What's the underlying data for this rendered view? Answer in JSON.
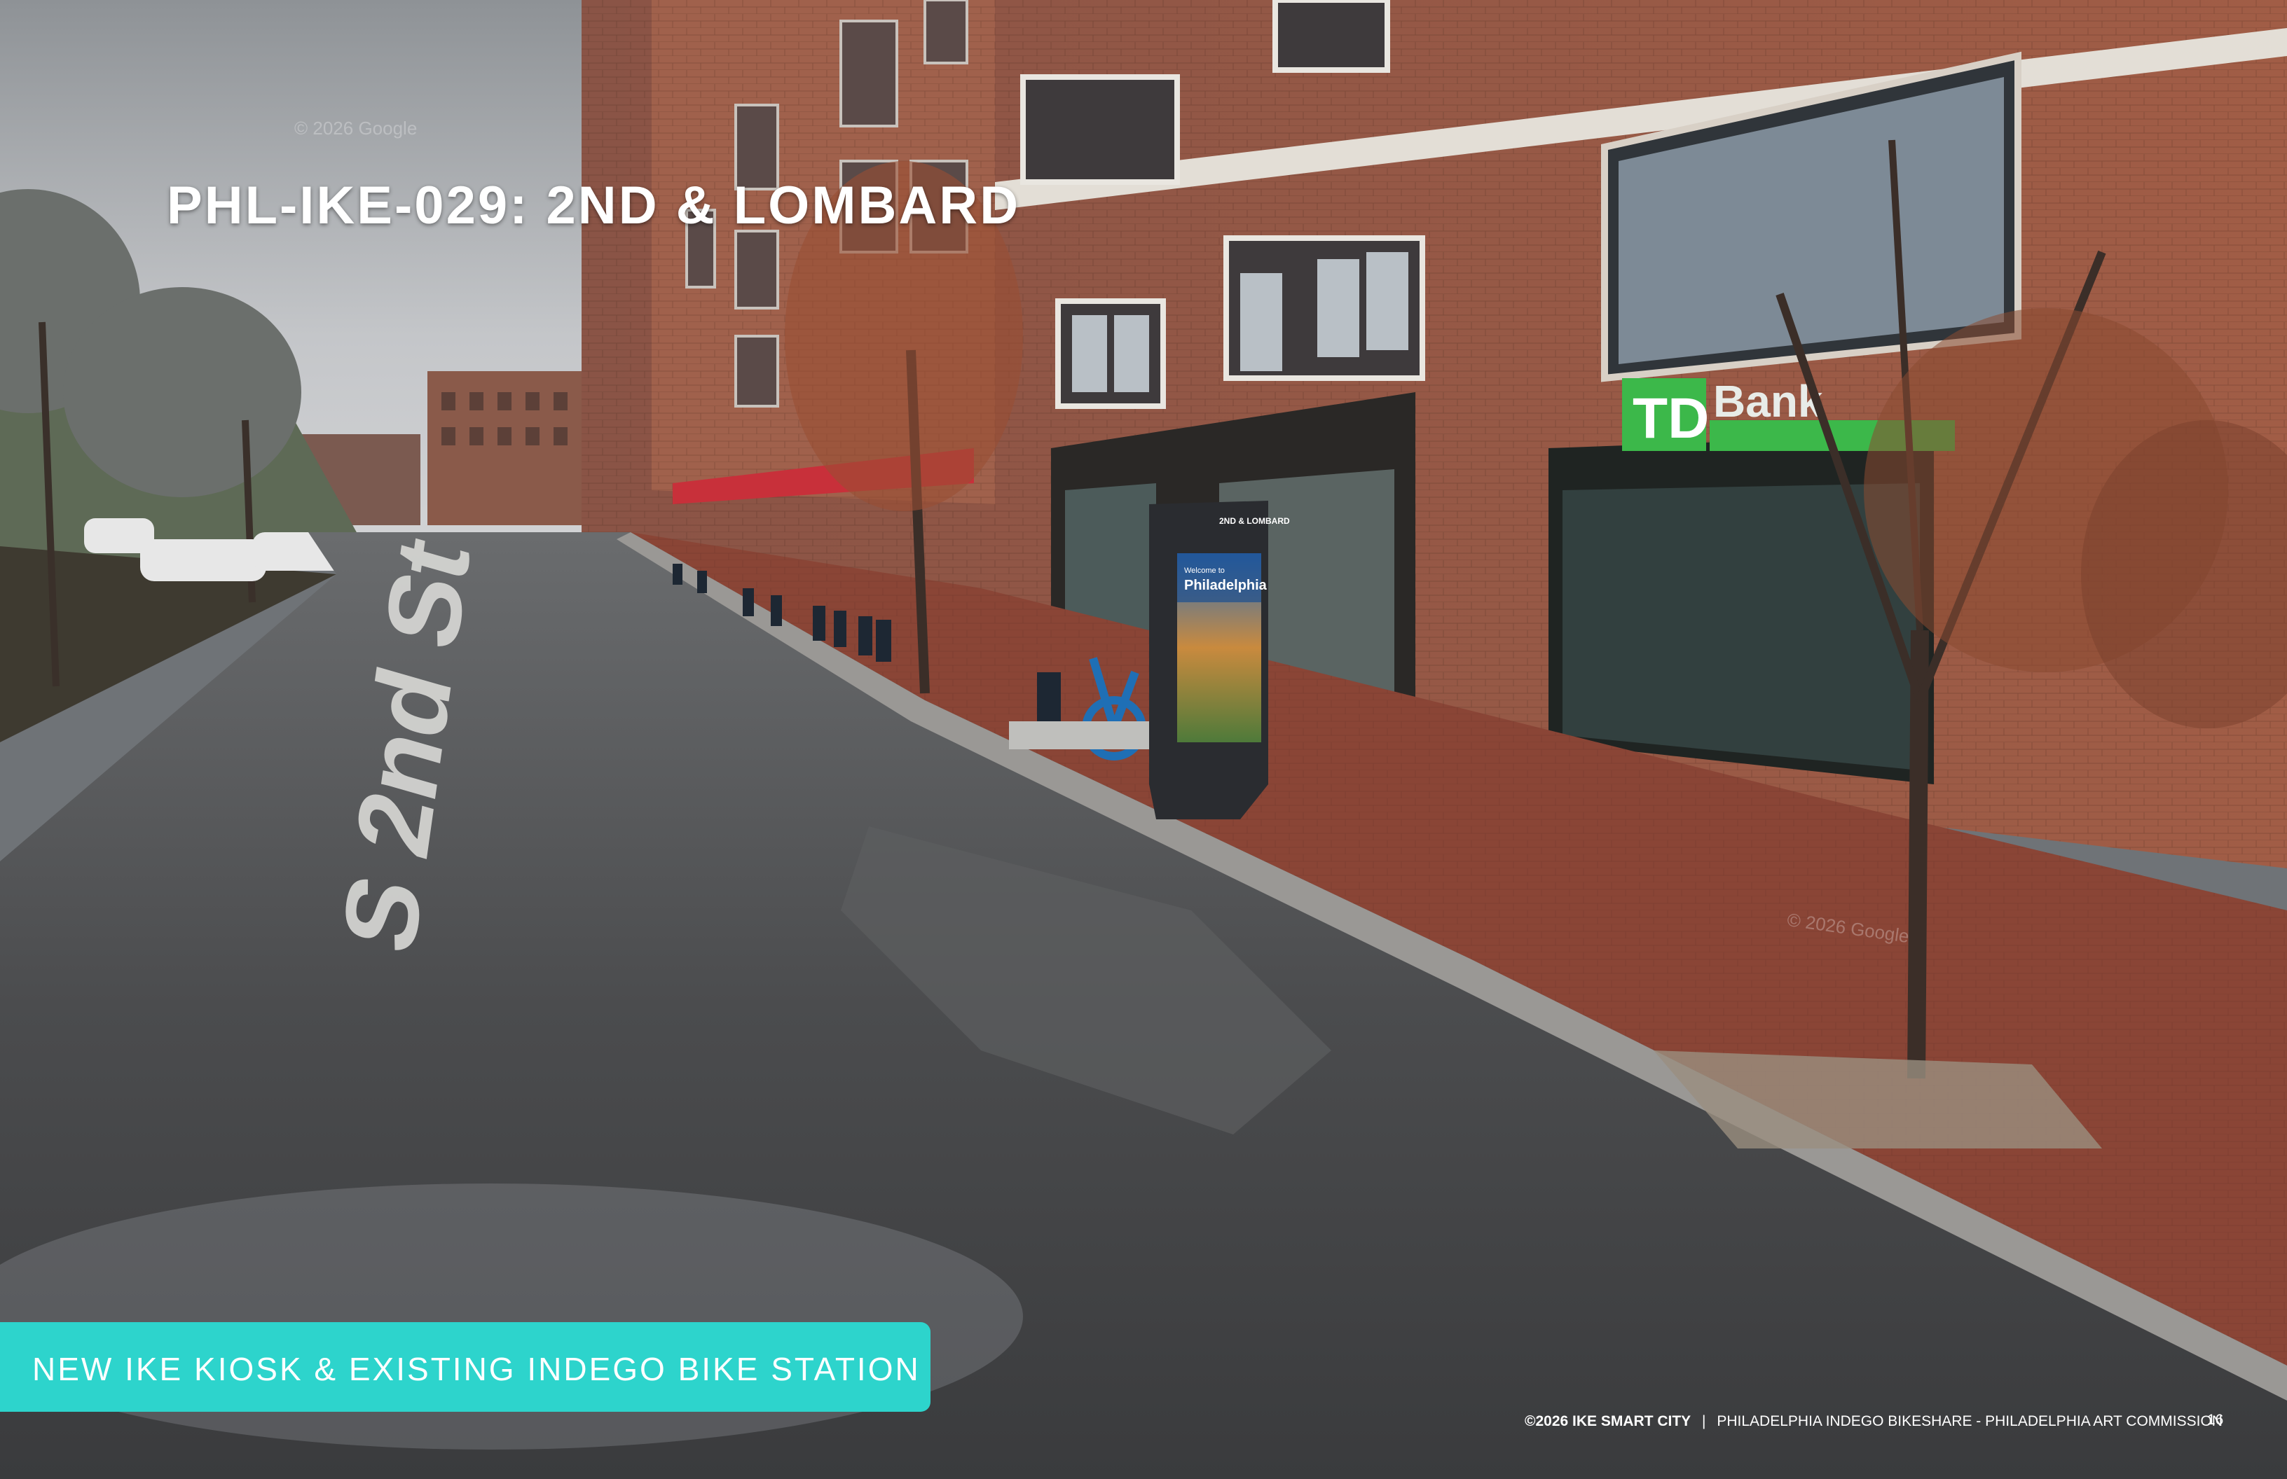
{
  "slide": {
    "title": "PHL-IKE-029: 2ND & LOMBARD",
    "caption": "NEW IKE KIOSK & EXISTING INDEGO BIKE STATION",
    "footer_brand": "©2026 IKE SMART CITY",
    "footer_separator": "|",
    "footer_text": "PHILADELPHIA INDEGO BIKESHARE - PHILADELPHIA ART COMMISSION",
    "page_number": "16"
  },
  "photo": {
    "street_marking": "S 2nd St",
    "bank_sign": "Bank",
    "bank_logo": "TD",
    "kiosk_header": "2ND & LOMBARD",
    "kiosk_screen_line1": "Welcome to",
    "kiosk_screen_line2": "Philadelphia",
    "watermark": "© 2026 Google"
  },
  "colors": {
    "caption_background": "#2dd4cc",
    "bank_green": "#3cb84a",
    "brick": "#9a5a45",
    "sidewalk": "#8a4536",
    "asphalt": "#4a4b4c",
    "sky": "#c9cbce",
    "kiosk_body": "#2a2c30"
  }
}
